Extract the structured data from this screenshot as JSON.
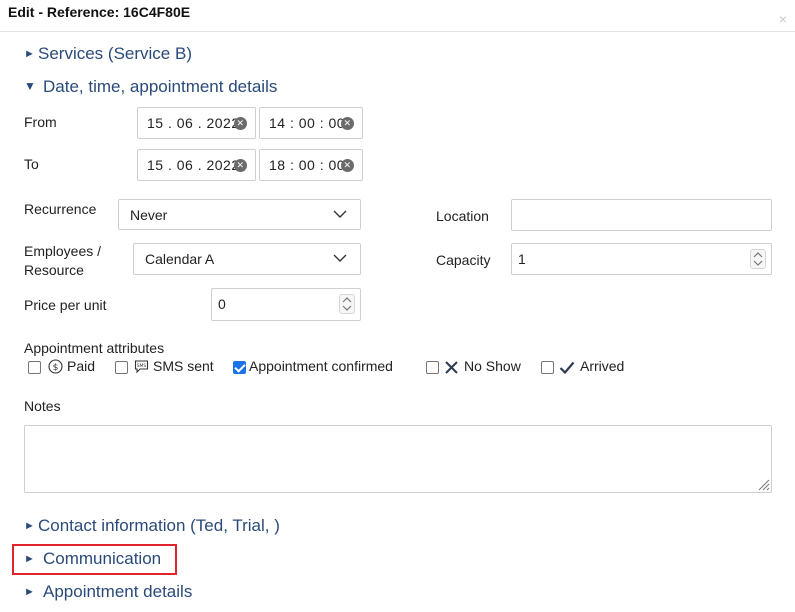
{
  "window": {
    "title": "Edit - Reference: 16C4F80E",
    "close_glyph": "×"
  },
  "sections": {
    "services": {
      "label": "Services (Service B)",
      "arrow": "►"
    },
    "datetime": {
      "label": "Date, time, appointment details",
      "arrow": "▼"
    },
    "contact": {
      "label": "Contact information (Ted, Trial, )",
      "arrow": "►"
    },
    "communication": {
      "label": "Communication",
      "arrow": "►"
    },
    "appointment_details": {
      "label": "Appointment details",
      "arrow": "►"
    }
  },
  "form": {
    "from_label": "From",
    "to_label": "To",
    "from_date": "15 . 06 . 2022",
    "from_time": "14 : 00 : 00",
    "to_date": "15 . 06 . 2022",
    "to_time": "18 : 00 : 00",
    "clear_glyph": "✕",
    "recurrence_label": "Recurrence",
    "recurrence_value": "Never",
    "employees_label_line1": "Employees /",
    "employees_label_line2": "Resource",
    "employees_value": "Calendar A",
    "price_label": "Price per unit",
    "price_value": "0",
    "location_label": "Location",
    "location_value": "",
    "capacity_label": "Capacity",
    "capacity_value": "1",
    "attributes_label": "Appointment attributes",
    "attributes": [
      {
        "label": "Paid",
        "checked": false,
        "icon": "dollar-circle-icon"
      },
      {
        "label": "SMS sent",
        "checked": false,
        "icon": "sms-icon"
      },
      {
        "label": "Appointment confirmed",
        "checked": true,
        "icon": ""
      },
      {
        "label": "No Show",
        "checked": false,
        "icon": "x-mark-icon"
      },
      {
        "label": "Arrived",
        "checked": false,
        "icon": "checkmark-icon"
      }
    ],
    "notes_label": "Notes",
    "notes_value": ""
  },
  "colors": {
    "section_link": "#2a4a7a",
    "checkbox_checked": "#1a73e8",
    "highlight": "#e0242a"
  }
}
